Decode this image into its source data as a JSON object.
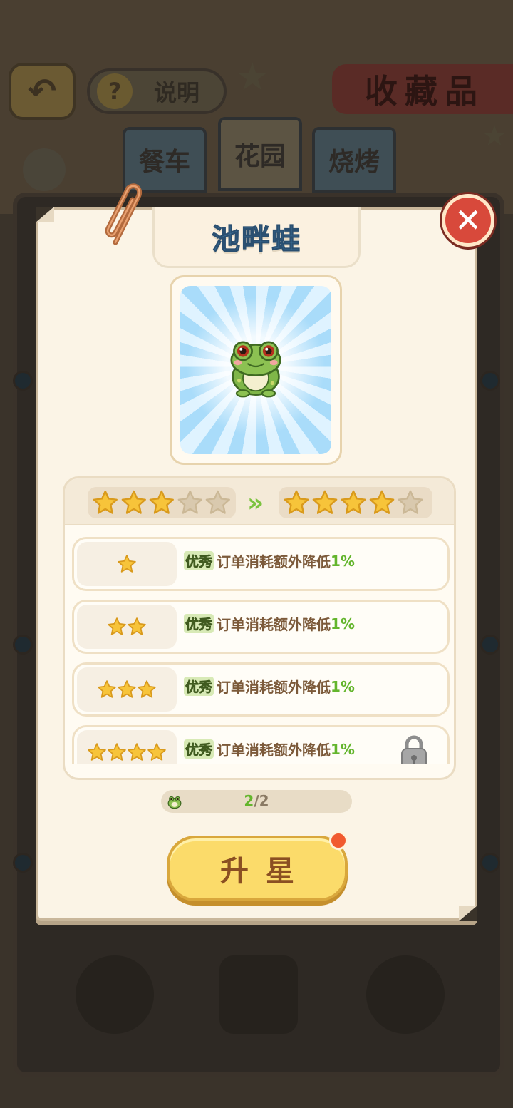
{
  "background": {
    "help_label": "说明",
    "help_icon": "question-icon",
    "collection_title": "收藏品",
    "tabs": [
      {
        "label": "餐车"
      },
      {
        "label": "花园"
      },
      {
        "label": "烧烤"
      }
    ]
  },
  "modal": {
    "title": "池畔蛙",
    "close_icon": "close-icon",
    "card_icon": "frog-icon",
    "star_upgrade": {
      "current_stars": 3,
      "next_stars": 4,
      "max_stars": 5,
      "arrow": "»"
    },
    "rows": [
      {
        "stars": 1,
        "badge": "优秀",
        "effect": "订单消耗额外降低",
        "value": "1%",
        "locked": false
      },
      {
        "stars": 2,
        "badge": "优秀",
        "effect": "订单消耗额外降低",
        "value": "1%",
        "locked": false
      },
      {
        "stars": 3,
        "badge": "优秀",
        "effect": "订单消耗额外降低",
        "value": "1%",
        "locked": false
      },
      {
        "stars": 4,
        "badge": "优秀",
        "effect": "订单消耗额外降低",
        "value": "1%",
        "locked": true
      }
    ],
    "progress": {
      "current": "2",
      "total": "2",
      "separator": "/"
    },
    "upgrade_button_label": "升星"
  },
  "colors": {
    "title_blue": "#3a6f98",
    "percent_green": "#63b52c",
    "close_red": "#d8493b",
    "button_yellow": "#fbdb6a",
    "star_gold": "#f7c43a"
  }
}
